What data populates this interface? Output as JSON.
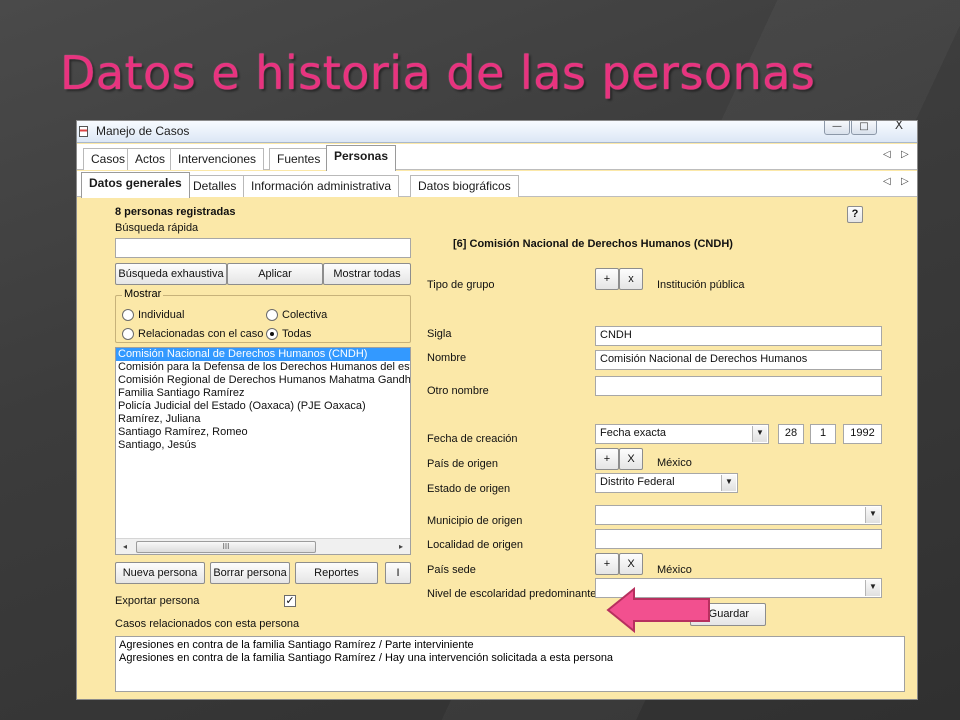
{
  "slide": {
    "title": "Datos e historia de las personas",
    "title_color": "#e8337f"
  },
  "window": {
    "title": "Manejo de Casos",
    "controls": {
      "minimize": "—",
      "maximize": "□",
      "close": "X"
    }
  },
  "main_tabs": [
    {
      "label": "Casos"
    },
    {
      "label": "Actos"
    },
    {
      "label": "Intervenciones"
    },
    {
      "label": "Fuentes"
    },
    {
      "label": "Personas",
      "active": true
    }
  ],
  "sub_tabs": [
    {
      "label": "Datos generales",
      "active": true
    },
    {
      "label": "Detalles"
    },
    {
      "label": "Información administrativa"
    },
    {
      "label": "Datos biográficos"
    }
  ],
  "tab_arrows": {
    "left": "◁",
    "right": "▷"
  },
  "left": {
    "count_label": "8 personas registradas",
    "quick_search_label": "Búsqueda rápida",
    "quick_search_value": "",
    "buttons": {
      "exhaustive": "Búsqueda exhaustiva",
      "apply": "Aplicar",
      "show_all": "Mostrar todas"
    },
    "show_group": {
      "legend": "Mostrar",
      "options": {
        "individual": "Individual",
        "colectiva": "Colectiva",
        "relacionadas": "Relacionadas con el caso",
        "todas": "Todas"
      },
      "selected": "todas"
    },
    "persons": [
      "Comisión Nacional de Derechos Humanos (CNDH)",
      "Comisión para la Defensa de los Derechos Humanos del estado",
      "Comisión Regional de Derechos Humanos Mahatma Gandhi (C",
      "Familia Santiago Ramírez",
      "Policía Judicial del Estado (Oaxaca) (PJE Oaxaca)",
      "Ramírez, Juliana",
      "Santiago Ramírez, Romeo",
      "Santiago, Jesús"
    ],
    "selected_index": 0,
    "scroll": {
      "left": "◂",
      "right": "▸",
      "thumb": "III"
    },
    "action_buttons": {
      "new": "Nueva persona",
      "delete": "Borrar persona",
      "reports": "Reportes",
      "info": "I"
    },
    "export_label": "Exportar persona",
    "export_checked": "✓"
  },
  "right": {
    "help": "?",
    "heading": "[6] Comisión Nacional de Derechos Humanos (CNDH)",
    "add": "+",
    "remove": "x",
    "group_type_label": "Tipo de grupo",
    "group_type_value": "Institución pública",
    "acronym_label": "Sigla",
    "acronym_value": "CNDH",
    "name_label": "Nombre",
    "name_value": "Comisión Nacional de Derechos Humanos",
    "other_name_label": "Otro nombre",
    "other_name_value": "",
    "creation_date_label": "Fecha de creación",
    "date_type_value": "Fecha exacta",
    "date_day": "28",
    "date_month": "1",
    "date_year": "1992",
    "origin_country_label": "País de origen",
    "origin_country_value": "México",
    "origin_state_label": "Estado de origen",
    "origin_state_value": "Distrito Federal",
    "origin_municipality_label": "Municipio de origen",
    "origin_locality_label": "Localidad de origen",
    "seat_country_label": "País sede",
    "seat_country_value": "México",
    "seat_add": "+",
    "seat_remove": "X",
    "origin_remove": "X",
    "education_label": "Nivel de escolaridad predominante",
    "save_button": "Guardar",
    "dropdown_arrow": "▼"
  },
  "cases": {
    "label": "Casos relacionados con esta persona",
    "items": [
      "Agresiones en contra de la familia Santiago Ramírez / Parte interviniente",
      "Agresiones en contra de la familia Santiago Ramírez / Hay una intervención solicitada a esta persona"
    ]
  },
  "colors": {
    "panel_bg": "#fbe8a8",
    "selection": "#3399ff",
    "callout_arrow": "#f2508f"
  }
}
